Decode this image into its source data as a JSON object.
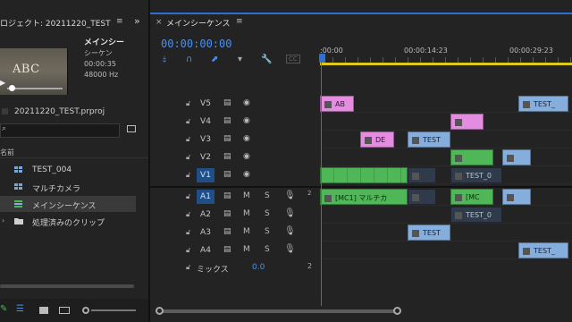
{
  "project": {
    "title": "ロジェクト: 20211220_TEST",
    "menu_icon": "hamburger-icon",
    "more_icon": "double-chevron-icon",
    "thumb_text": "ABC",
    "clip_info": {
      "name": "メインシー",
      "type": "シーケン",
      "duration": "00:00:35",
      "audio": "48000 Hz"
    },
    "file_name": "20211220_TEST.prproj",
    "column_name": "名前",
    "items": [
      {
        "label": "TEST_004",
        "icon": "multicam-clip-icon",
        "selected": false
      },
      {
        "label": "マルチカメラ",
        "icon": "multicam-clip-icon",
        "selected": false
      },
      {
        "label": "メインシーケンス",
        "icon": "sequence-icon",
        "selected": true
      },
      {
        "label": "処理済みのクリップ",
        "icon": "folder-icon",
        "selected": false
      }
    ]
  },
  "timeline": {
    "tab_title": "メインシーケンス",
    "timecode": "00:00:00:00",
    "ruler": [
      ":00:00",
      "00:00:14:23",
      "00:00:29:23"
    ],
    "tools": [
      "insert-tool-icon",
      "snap-icon",
      "linked-selection-icon",
      "marker-icon",
      "settings-icon",
      "captions-icon"
    ],
    "video_tracks": [
      {
        "name": "V5",
        "target": false
      },
      {
        "name": "V4",
        "target": false
      },
      {
        "name": "V3",
        "target": false
      },
      {
        "name": "V2",
        "target": false
      },
      {
        "name": "V1",
        "target": true
      }
    ],
    "audio_tracks": [
      {
        "name": "A1",
        "target": true,
        "m": "M",
        "s": "S"
      },
      {
        "name": "A2",
        "target": false,
        "m": "M",
        "s": "S"
      },
      {
        "name": "A3",
        "target": false,
        "m": "M",
        "s": "S"
      },
      {
        "name": "A4",
        "target": false,
        "m": "M",
        "s": "S"
      }
    ],
    "audio_marker": "2",
    "mix": {
      "label": "ミックス",
      "value": "0.0"
    },
    "clips": {
      "v5_ab": "AB",
      "v5_test": "TEST_",
      "v3_de": "DE",
      "v3_test": "TEST",
      "v1_test": "TEST_0",
      "a1_mc1": "[MC1] マルチカ",
      "a1_mc": "[MC",
      "a2_test": "TEST_0",
      "a3_test": "TEST",
      "a4_test": "TEST_"
    }
  },
  "colors": {
    "accent": "#2f6fd6",
    "video_clip": "#4fb757",
    "pink_clip": "#e48ce0",
    "blue_clip": "#86aedd",
    "workarea": "#e0c91a"
  }
}
